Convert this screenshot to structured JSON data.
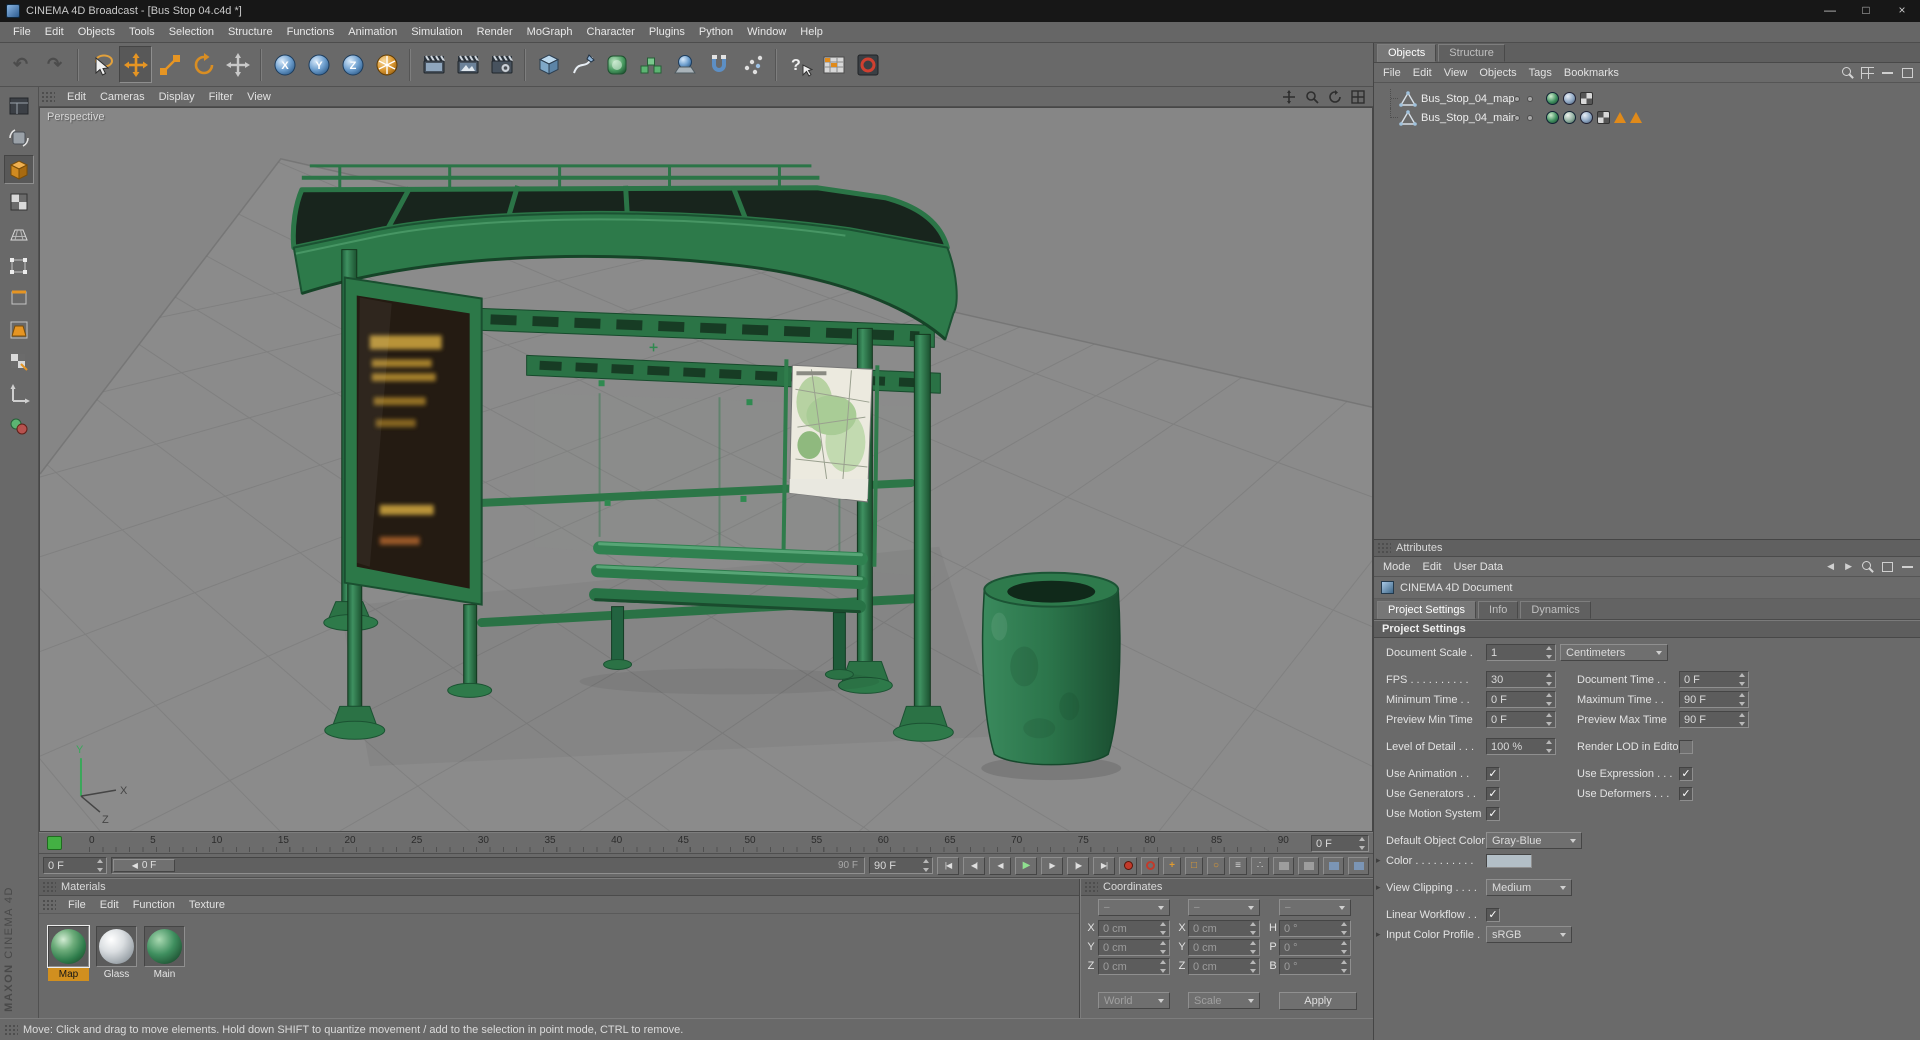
{
  "titlebar": {
    "title": "CINEMA 4D Broadcast - [Bus Stop 04.c4d *]"
  },
  "window_controls": {
    "minimize": "—",
    "maximize": "□",
    "close": "×"
  },
  "menubar": {
    "items": [
      "File",
      "Edit",
      "Objects",
      "Tools",
      "Selection",
      "Structure",
      "Functions",
      "Animation",
      "Simulation",
      "Render",
      "MoGraph",
      "Character",
      "Plugins",
      "Python",
      "Window",
      "Help"
    ]
  },
  "toolbar": {
    "undo": "↶",
    "redo": "↷",
    "axis": [
      "X",
      "Y",
      "Z"
    ]
  },
  "viewport": {
    "menu": [
      "Edit",
      "Cameras",
      "Display",
      "Filter",
      "View"
    ],
    "view_label": "Perspective",
    "axis": {
      "x": "X",
      "y": "Y",
      "z": "Z"
    }
  },
  "timeline": {
    "ticks": [
      "0",
      "5",
      "10",
      "15",
      "20",
      "25",
      "30",
      "35",
      "40",
      "45",
      "50",
      "55",
      "60",
      "65",
      "70",
      "75",
      "80",
      "85",
      "90"
    ],
    "ruler_frame_display": "0 F",
    "current_frame": "0 F",
    "slider_handle_arrow": "◀",
    "slider_handle": "0 F",
    "slider_end": "90 F",
    "end_frame": "90 F",
    "transport": {
      "jump_start": "|◀",
      "prev_key": "◀|",
      "prev_frame": "◀",
      "play": "▶",
      "next_frame": "▶",
      "next_key": "|▶",
      "jump_end": "▶|"
    },
    "record": {
      "position": "+",
      "scale": "□",
      "rotation": "○",
      "parameter": "≡",
      "pla": "∴"
    }
  },
  "materials": {
    "title": "Materials",
    "menu": [
      "File",
      "Edit",
      "Function",
      "Texture"
    ],
    "items": [
      {
        "name": "Map"
      },
      {
        "name": "Glass"
      },
      {
        "name": "Main"
      }
    ]
  },
  "coordinates": {
    "title": "Coordinates",
    "col_headers": [
      "–",
      "–",
      "–"
    ],
    "labels": {
      "px": "X",
      "py": "Y",
      "pz": "Z",
      "sx": "X",
      "sy": "Y",
      "sz": "Z",
      "rh": "H",
      "rp": "P",
      "rb": "B"
    },
    "values": {
      "px": "0 cm",
      "py": "0 cm",
      "pz": "0 cm",
      "sx": "0 cm",
      "sy": "0 cm",
      "sz": "0 cm",
      "rh": "0 °",
      "rp": "0 °",
      "rb": "0 °"
    },
    "world": "World",
    "scale": "Scale",
    "apply": "Apply"
  },
  "object_manager": {
    "tabs": [
      "Objects",
      "Structure"
    ],
    "menu": [
      "File",
      "Edit",
      "View",
      "Objects",
      "Tags",
      "Bookmarks"
    ],
    "objects": [
      {
        "name": "Bus_Stop_04_map"
      },
      {
        "name": "Bus_Stop_04_main"
      }
    ]
  },
  "attributes": {
    "title": "Attributes",
    "menu": [
      "Mode",
      "Edit",
      "User Data"
    ],
    "document": "CINEMA 4D Document",
    "tabs": [
      "Project Settings",
      "Info",
      "Dynamics"
    ],
    "section": "Project Settings",
    "check": "✓",
    "caret": "▸",
    "rows": {
      "document_scale": {
        "label": "Document Scale .",
        "value": "1",
        "unit": "Centimeters"
      },
      "fps": {
        "label": "FPS . . . . . . . . . .",
        "value": "30"
      },
      "document_time": {
        "label": "Document Time . .",
        "value": "0 F"
      },
      "minimum_time": {
        "label": "Minimum Time . .",
        "value": "0 F"
      },
      "maximum_time": {
        "label": "Maximum Time . .",
        "value": "90 F"
      },
      "preview_min_time": {
        "label": "Preview Min Time",
        "value": "0 F"
      },
      "preview_max_time": {
        "label": "Preview Max Time",
        "value": "90 F"
      },
      "level_of_detail": {
        "label": "Level of Detail . . .",
        "value": "100 %"
      },
      "render_lod": {
        "label": "Render LOD in Editor"
      },
      "use_animation": {
        "label": "Use Animation . ."
      },
      "use_expression": {
        "label": "Use Expression . . ."
      },
      "use_generators": {
        "label": "Use Generators . ."
      },
      "use_deformers": {
        "label": "Use Deformers . . ."
      },
      "use_motion_system": {
        "label": "Use Motion System"
      },
      "default_object_color": {
        "label": "Default Object Color",
        "value": "Gray-Blue"
      },
      "color": {
        "label": "Color . . . . . . . . . ."
      },
      "view_clipping": {
        "label": "View Clipping . . . .",
        "value": "Medium"
      },
      "linear_workflow": {
        "label": "Linear Workflow . ."
      },
      "input_color_profile": {
        "label": "Input Color Profile .",
        "value": "sRGB"
      }
    }
  },
  "statusbar": {
    "text": "Move: Click and drag to move elements. Hold down SHIFT to quantize movement / add to the selection in point mode, CTRL to remove."
  },
  "branding": {
    "maxon": "MAXON",
    "cinema": "CINEMA 4D"
  },
  "colors": {
    "accent_orange": "#d18f1f",
    "c4d_green": "#2e7c4b",
    "timeline_green": "#43b043",
    "panel_gray": "#6a6a6a"
  }
}
